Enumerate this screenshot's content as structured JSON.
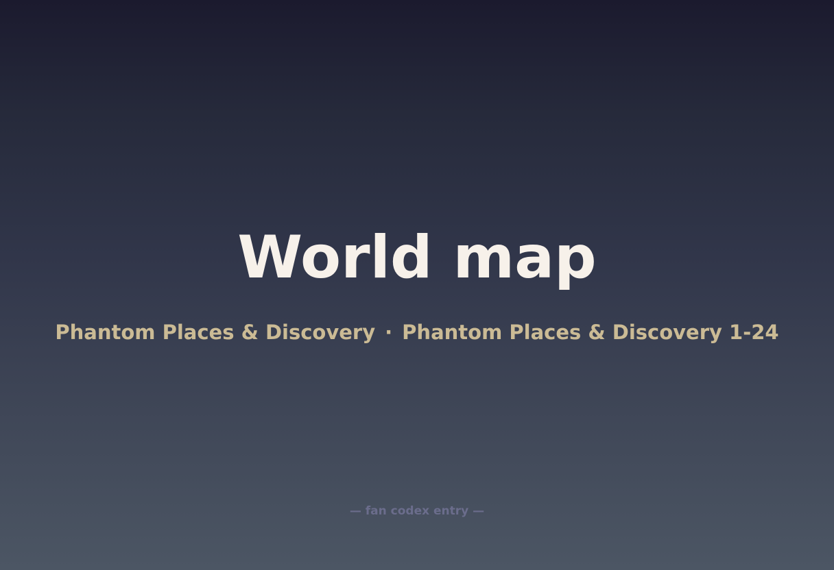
{
  "title": "World map",
  "subtitle": {
    "left": "Phantom Places & Discovery",
    "separator": "·",
    "right": "Phantom Places & Discovery 1-24"
  },
  "footer": "— fan codex entry —",
  "colors": {
    "title": "#f7f1ea",
    "subtitle": "#cbbb95",
    "footer": "#6b6d8c",
    "background_top": "#1b1a2e",
    "background_bottom": "#4c5664"
  }
}
